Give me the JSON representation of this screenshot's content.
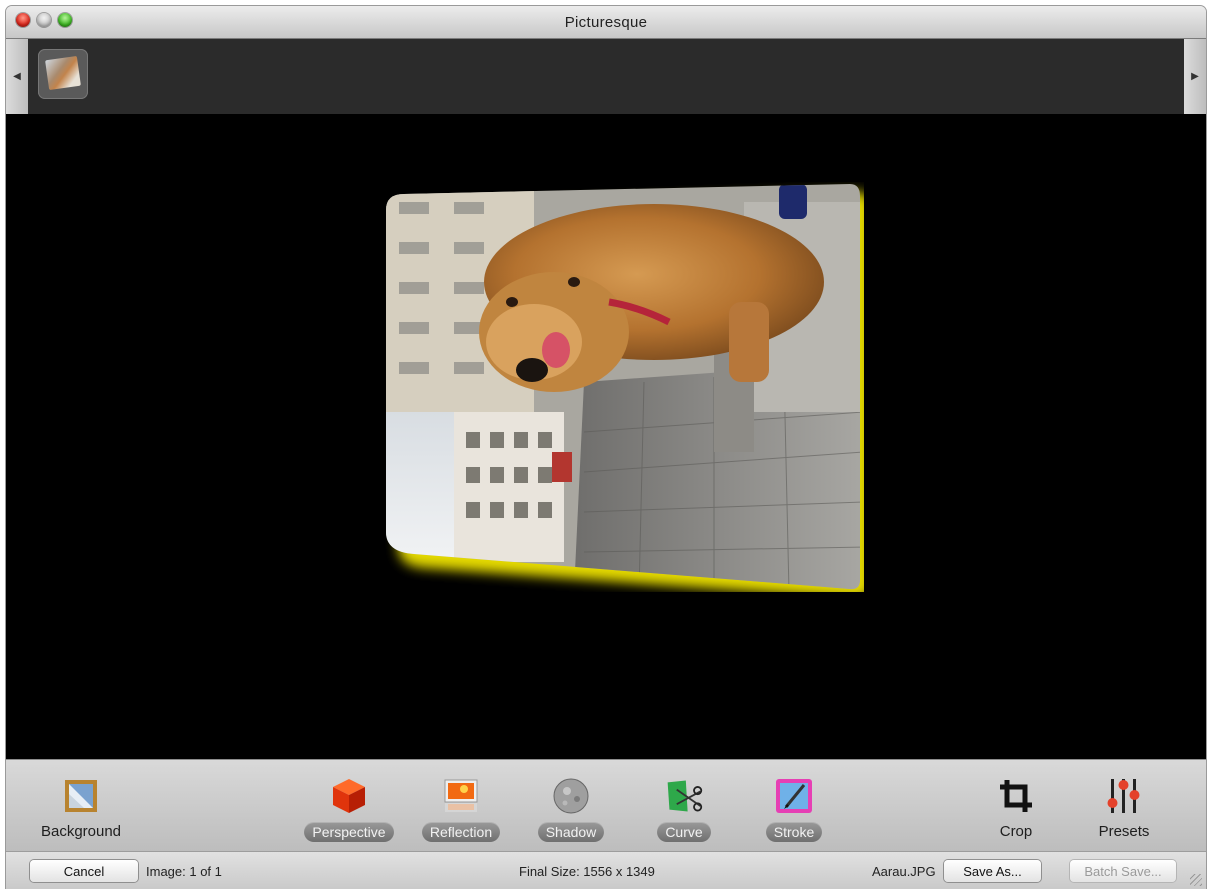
{
  "window": {
    "title": "Picturesque"
  },
  "filmstrip": {
    "prev_icon": "triangle-left-icon",
    "next_icon": "triangle-right-icon",
    "thumbnail_count": 1
  },
  "canvas": {
    "background": "#000000",
    "glow_color": "#f2e600"
  },
  "toolbar": {
    "background_label": "Background",
    "perspective_label": "Perspective",
    "reflection_label": "Reflection",
    "shadow_label": "Shadow",
    "curve_label": "Curve",
    "stroke_label": "Stroke",
    "crop_label": "Crop",
    "presets_label": "Presets"
  },
  "status": {
    "cancel_label": "Cancel",
    "image_count": "Image: 1 of 1",
    "final_size": "Final Size: 1556 x 1349",
    "filename": "Aarau.JPG",
    "save_as_label": "Save As...",
    "batch_save_label": "Batch Save..."
  }
}
